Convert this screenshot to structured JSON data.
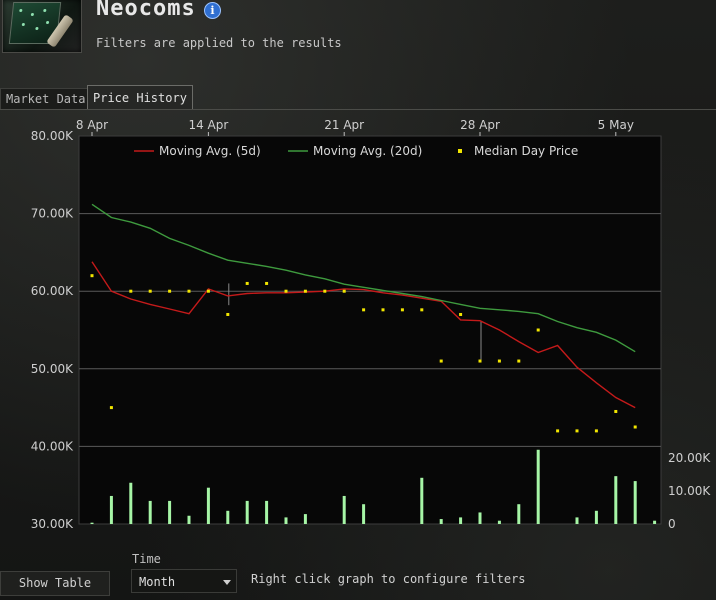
{
  "header": {
    "title": "Neocoms",
    "subtitle": "Filters are applied to the results",
    "icon": "neocom-datapad-icon",
    "info_icon": "info-icon"
  },
  "tabs": [
    {
      "label": "Market Data",
      "active": false
    },
    {
      "label": "Price History",
      "active": true
    }
  ],
  "chart_data": {
    "type": "line",
    "x_tick_labels": [
      "8 Apr",
      "14 Apr",
      "21 Apr",
      "28 Apr",
      "5 May"
    ],
    "x_tick_days": [
      0,
      6,
      13,
      20,
      27
    ],
    "days": [
      0,
      1,
      2,
      3,
      4,
      5,
      6,
      7,
      8,
      9,
      10,
      11,
      12,
      13,
      14,
      15,
      16,
      17,
      18,
      19,
      20,
      21,
      22,
      23,
      24,
      25,
      26,
      27,
      28
    ],
    "price_axis": {
      "ticks": [
        30000,
        40000,
        50000,
        60000,
        70000,
        80000
      ],
      "labels": [
        "30.00K",
        "40.00K",
        "50.00K",
        "60.00K",
        "70.00K",
        "80.00K"
      ],
      "ylim": [
        30000,
        80000
      ]
    },
    "volume_axis": {
      "ticks": [
        0,
        10000,
        20000
      ],
      "labels": [
        "0",
        "10.00K",
        "20.00K"
      ],
      "ylim": [
        0,
        20000
      ]
    },
    "legend": [
      "Moving Avg.  (5d)",
      "Moving Avg.  (20d)",
      "Median Day Price"
    ],
    "colors": {
      "ma5": "#c41a1a",
      "ma20": "#3e9a3e",
      "median": "#f2e600",
      "volume": "#a6f5a6",
      "grid": "#5a5a5a",
      "plot_bg": "#070707"
    },
    "series": [
      {
        "name": "Moving Avg.  (5d)",
        "values": [
          63800,
          60000,
          59000,
          58300,
          57700,
          57100,
          60300,
          59400,
          59700,
          59800,
          59800,
          59900,
          60000,
          60300,
          60200,
          59800,
          59500,
          59100,
          58700,
          56300,
          56200,
          55000,
          53500,
          52100,
          53000,
          50200,
          48200,
          46300,
          45000
        ]
      },
      {
        "name": "Moving Avg.  (20d)",
        "values": [
          71200,
          69500,
          68900,
          68100,
          66800,
          65900,
          64900,
          64000,
          63600,
          63200,
          62700,
          62100,
          61600,
          60900,
          60500,
          60100,
          59700,
          59300,
          58800,
          58300,
          57800,
          57600,
          57400,
          57100,
          56100,
          55300,
          54700,
          53700,
          52200
        ]
      },
      {
        "name": "Median Day Price",
        "values": [
          62000,
          45000,
          60000,
          60000,
          60000,
          60000,
          60000,
          57000,
          61000,
          61000,
          60000,
          60000,
          60000,
          60000,
          57600,
          57600,
          57600,
          57600,
          51000,
          57000,
          51000,
          51000,
          51000,
          55000,
          42000,
          42000,
          42000,
          44500,
          42500
        ]
      },
      {
        "name": "Volume",
        "values": [
          400,
          8500,
          12500,
          7000,
          7000,
          2500,
          11000,
          4000,
          7000,
          7000,
          2000,
          3000,
          0,
          8500,
          6000,
          0,
          0,
          14000,
          1500,
          2000,
          3500,
          1000,
          6000,
          22500,
          0,
          2000,
          4000,
          14500,
          13000,
          1000
        ]
      }
    ],
    "min_max_bars": [
      {
        "day": 7,
        "low": 58200,
        "high": 61000
      },
      {
        "day": 20,
        "low": 51200,
        "high": 56200
      }
    ],
    "grid": true,
    "legend_placement": "top"
  },
  "footer": {
    "show_table_label": "Show Table",
    "time_label": "Time",
    "time_value": "Month",
    "hint": "Right click graph to configure filters"
  }
}
